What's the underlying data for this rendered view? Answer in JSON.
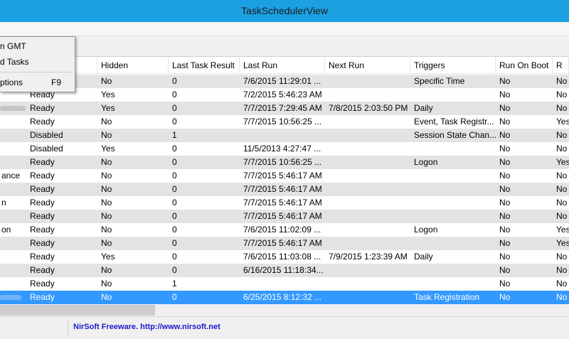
{
  "window": {
    "title": "TaskSchedulerView"
  },
  "menu": {
    "items": [
      {
        "label": "n GMT",
        "shortcut": ""
      },
      {
        "label": "d Tasks",
        "shortcut": ""
      },
      {
        "label": "ptions",
        "shortcut": "F9"
      }
    ]
  },
  "columns": [
    "",
    "Hidden",
    "Last Task Result",
    "Last Run",
    "Next Run",
    "Triggers",
    "Run On Boot",
    "R"
  ],
  "rows": [
    {
      "name": "",
      "status": "",
      "hidden": "No",
      "result": "0",
      "last_run": "7/6/2015 11:29:01 ...",
      "next_run": "",
      "triggers": "Specific Time",
      "run_on_boot": "No",
      "extra": "No"
    },
    {
      "name": "",
      "status": "Ready",
      "hidden": "Yes",
      "result": "0",
      "last_run": "7/2/2015 5:46:23 AM",
      "next_run": "",
      "triggers": "",
      "run_on_boot": "No",
      "extra": "No"
    },
    {
      "name": "",
      "status": "Ready",
      "hidden": "Yes",
      "result": "0",
      "last_run": "7/7/2015 7:29:45 AM",
      "next_run": "7/8/2015 2:03:50 PM",
      "triggers": "Daily",
      "run_on_boot": "No",
      "extra": "No"
    },
    {
      "name": "",
      "status": "Ready",
      "hidden": "No",
      "result": "0",
      "last_run": "7/7/2015 10:56:25 ...",
      "next_run": "",
      "triggers": "Event, Task Registr...",
      "run_on_boot": "No",
      "extra": "Yes"
    },
    {
      "name": "",
      "status": "Disabled",
      "hidden": "No",
      "result": "1",
      "last_run": "",
      "next_run": "",
      "triggers": "Session State Chan...",
      "run_on_boot": "No",
      "extra": "No"
    },
    {
      "name": "",
      "status": "Disabled",
      "hidden": "Yes",
      "result": "0",
      "last_run": "11/5/2013 4:27:47 ...",
      "next_run": "",
      "triggers": "",
      "run_on_boot": "No",
      "extra": "No"
    },
    {
      "name": "",
      "status": "Ready",
      "hidden": "No",
      "result": "0",
      "last_run": "7/7/2015 10:56:25 ...",
      "next_run": "",
      "triggers": "Logon",
      "run_on_boot": "No",
      "extra": "Yes"
    },
    {
      "name": "ance",
      "status": "Ready",
      "hidden": "No",
      "result": "0",
      "last_run": "7/7/2015 5:46:17 AM",
      "next_run": "",
      "triggers": "",
      "run_on_boot": "No",
      "extra": "No"
    },
    {
      "name": "",
      "status": "Ready",
      "hidden": "No",
      "result": "0",
      "last_run": "7/7/2015 5:46:17 AM",
      "next_run": "",
      "triggers": "",
      "run_on_boot": "No",
      "extra": "No"
    },
    {
      "name": "n",
      "status": "Ready",
      "hidden": "No",
      "result": "0",
      "last_run": "7/7/2015 5:46:17 AM",
      "next_run": "",
      "triggers": "",
      "run_on_boot": "No",
      "extra": "No"
    },
    {
      "name": "",
      "status": "Ready",
      "hidden": "No",
      "result": "0",
      "last_run": "7/7/2015 5:46:17 AM",
      "next_run": "",
      "triggers": "",
      "run_on_boot": "No",
      "extra": "No"
    },
    {
      "name": "on",
      "status": "Ready",
      "hidden": "No",
      "result": "0",
      "last_run": "7/6/2015 11:02:09 ...",
      "next_run": "",
      "triggers": "Logon",
      "run_on_boot": "No",
      "extra": "Yes"
    },
    {
      "name": "",
      "status": "Ready",
      "hidden": "No",
      "result": "0",
      "last_run": "7/7/2015 5:46:17 AM",
      "next_run": "",
      "triggers": "",
      "run_on_boot": "No",
      "extra": "Yes"
    },
    {
      "name": "",
      "status": "Ready",
      "hidden": "Yes",
      "result": "0",
      "last_run": "7/6/2015 11:03:08 ...",
      "next_run": "7/9/2015 1:23:39 AM",
      "triggers": "Daily",
      "run_on_boot": "No",
      "extra": "No"
    },
    {
      "name": "",
      "status": "Ready",
      "hidden": "No",
      "result": "0",
      "last_run": "6/16/2015 11:18:34...",
      "next_run": "",
      "triggers": "",
      "run_on_boot": "No",
      "extra": "No"
    },
    {
      "name": "",
      "status": "Ready",
      "hidden": "No",
      "result": "1",
      "last_run": "",
      "next_run": "",
      "triggers": "",
      "run_on_boot": "No",
      "extra": "No"
    },
    {
      "name": "",
      "status": "Ready",
      "hidden": "No",
      "result": "0",
      "last_run": "6/25/2015 8:12:32 ...",
      "next_run": "",
      "triggers": "Task Registration",
      "run_on_boot": "No",
      "extra": "No"
    }
  ],
  "selected_row": 16,
  "status_bar": {
    "link_text": "NirSoft Freeware.  http://www.nirsoft.net"
  },
  "colors": {
    "title_bar": "#1ba1e2",
    "alt_row": "#e3e3e3",
    "selected_row": "#3399ff",
    "link": "#1a1acc"
  }
}
